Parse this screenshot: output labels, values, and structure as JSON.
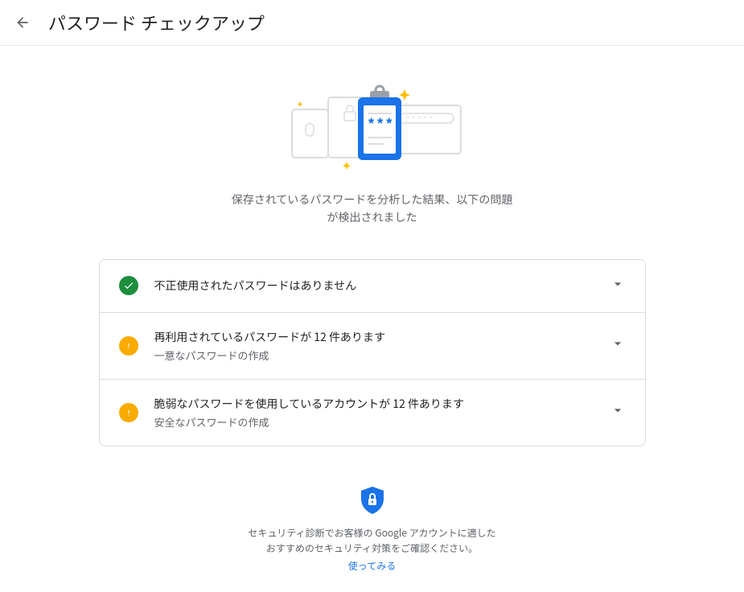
{
  "header": {
    "title": "パスワード チェックアップ"
  },
  "description": "保存されているパスワードを分析した結果、以下の問題が検出されました",
  "items": [
    {
      "status": "ok",
      "title": "不正使用されたパスワードはありません",
      "subtitle": ""
    },
    {
      "status": "warn",
      "title": "再利用されているパスワードが 12 件あります",
      "subtitle": "一意なパスワードの作成"
    },
    {
      "status": "warn",
      "title": "脆弱なパスワードを使用しているアカウントが 12 件あります",
      "subtitle": "安全なパスワードの作成"
    }
  ],
  "promo": {
    "text": "セキュリティ診断でお客様の Google アカウントに適したおすすめのセキュリティ対策をご確認ください。",
    "link_label": "使ってみる"
  }
}
